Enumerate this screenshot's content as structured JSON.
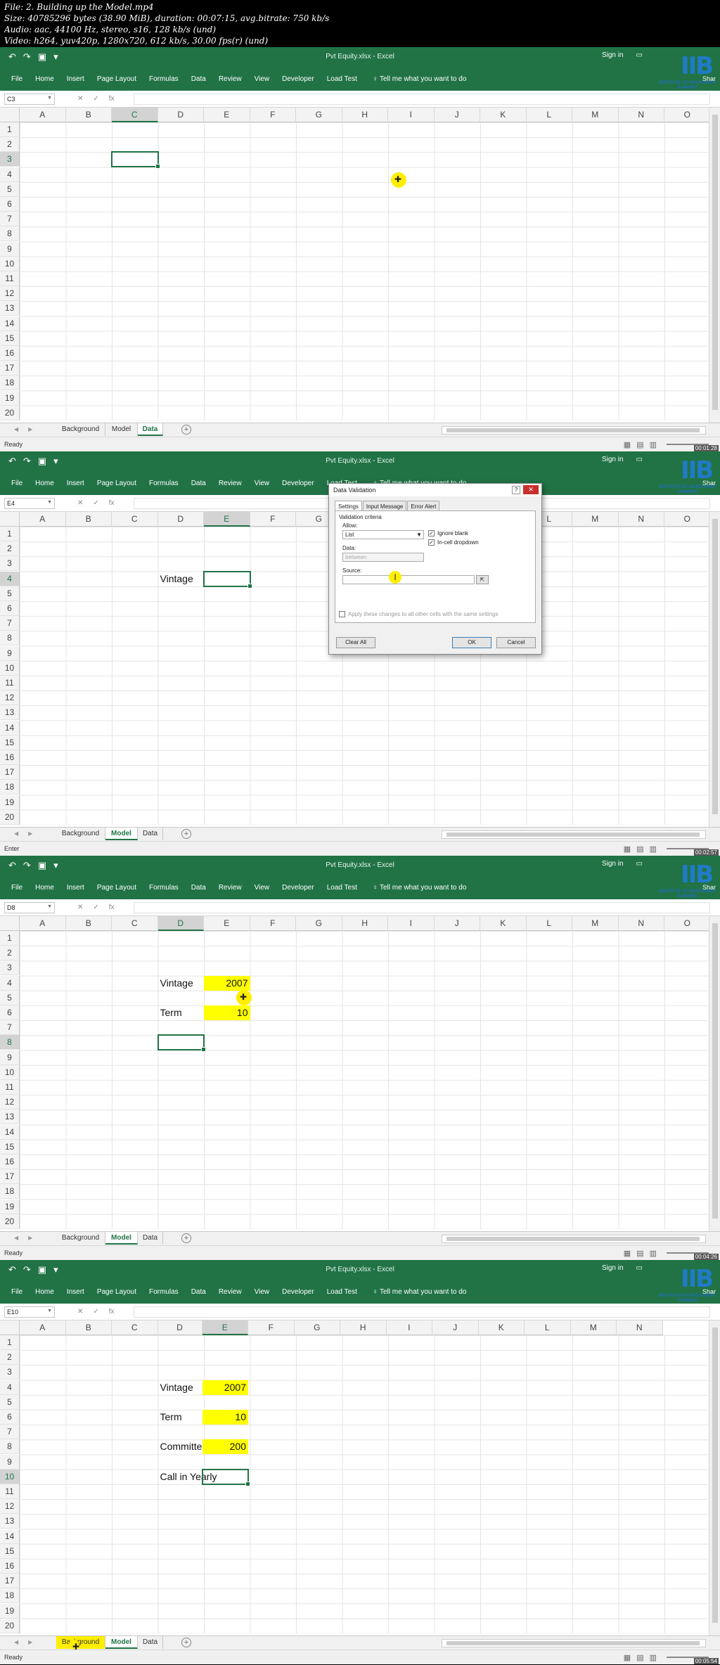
{
  "info": {
    "line1": "File: 2. Building up the Model.mp4",
    "line2": "Size: 40785296 bytes (38.90 MiB), duration: 00:07:15, avg.bitrate: 750 kb/s",
    "line3": "Audio: aac, 44100 Hz, stereo, s16, 128 kb/s (und)",
    "line4": "Video: h264, yuv420p, 1280x720, 612 kb/s, 30.00 fps(r) (und)"
  },
  "app": {
    "sign_in": "Sign in",
    "share": "Shar",
    "logo_letters": "IIB",
    "logo_text": "INSTITUTE OF INVESTMENT BANKING",
    "tabs": [
      "File",
      "Home",
      "Insert",
      "Page Layout",
      "Formulas",
      "Data",
      "Review",
      "View",
      "Developer",
      "Load Test"
    ],
    "tell_me": "Tell me what you want to do",
    "sheet_tabs": [
      "Background",
      "Model",
      "Data"
    ],
    "row_numbers": [
      "1",
      "2",
      "3",
      "4",
      "5",
      "6",
      "7",
      "8",
      "9",
      "10",
      "11",
      "12",
      "13",
      "14",
      "15",
      "16",
      "17",
      "18",
      "19",
      "20"
    ],
    "brand_color": "#217346"
  },
  "frames": [
    {
      "title": "Pvt Equity.xlsx - Excel",
      "namebox": "C3",
      "columns": [
        "A",
        "B",
        "C",
        "D",
        "E",
        "F",
        "G",
        "H",
        "I",
        "J",
        "K",
        "L",
        "M",
        "N",
        "O"
      ],
      "status": "Ready",
      "timestamp": "00:01:28",
      "cells": []
    },
    {
      "title": "Pvt Equity.xlsx - Excel",
      "namebox": "E4",
      "columns": [
        "A",
        "B",
        "C",
        "D",
        "E",
        "F",
        "G",
        "H",
        "I",
        "J",
        "K",
        "L",
        "M",
        "N",
        "O"
      ],
      "status": "Enter",
      "timestamp": "00:02:57",
      "cells": [
        {
          "label": "Vintage"
        }
      ]
    },
    {
      "title": "Pvt Equity.xlsx - Excel",
      "namebox": "D8",
      "columns": [
        "A",
        "B",
        "C",
        "D",
        "E",
        "F",
        "G",
        "H",
        "I",
        "J",
        "K",
        "L",
        "M",
        "N",
        "O"
      ],
      "status": "Ready",
      "timestamp": "00:04:26",
      "cells": [
        {
          "label": "Vintage",
          "value": "2007"
        },
        {
          "label": "Term",
          "value": "10"
        }
      ]
    },
    {
      "title": "Pvt Equity.xlsx - Excel",
      "namebox": "E10",
      "columns": [
        "A",
        "B",
        "C",
        "D",
        "E",
        "F",
        "G",
        "H",
        "I",
        "J",
        "K",
        "L",
        "M",
        "N"
      ],
      "status": "Ready",
      "timestamp": "00:05:54",
      "cells": [
        {
          "label": "Vintage",
          "value": "2007"
        },
        {
          "label": "Term",
          "value": "10"
        },
        {
          "label": "Committed Capital",
          "value": "200"
        },
        {
          "label": "Call in Yearly"
        }
      ]
    }
  ],
  "dialog": {
    "title": "Data Validation",
    "help": "?",
    "close": "✕",
    "tabs": [
      "Settings",
      "Input Message",
      "Error Alert"
    ],
    "section": "Validation criteria",
    "allow_label": "Allow:",
    "allow_value": "List",
    "data_label": "Data:",
    "data_value": "between",
    "source_label": "Source:",
    "ignore_blank": "Ignore blank",
    "incell_dropdown": "In-cell dropdown",
    "apply_all": "Apply these changes to all other cells with the same settings",
    "clear_all": "Clear All",
    "ok": "OK",
    "cancel": "Cancel"
  }
}
